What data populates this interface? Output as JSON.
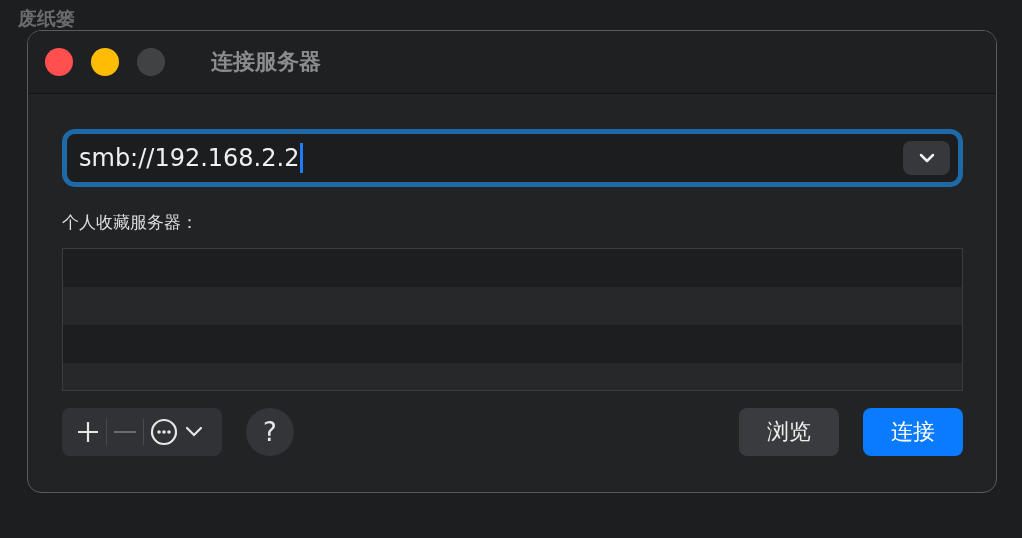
{
  "desktop": {
    "icon_label": "废纸篓"
  },
  "window": {
    "title": "连接服务器",
    "traffic_lights": [
      {
        "color": "#ff4f4f"
      },
      {
        "color": "#febc05"
      },
      {
        "color": "#404244"
      }
    ]
  },
  "address_field": {
    "value": "smb://192.168.2.2",
    "focused": true
  },
  "favorites": {
    "label": "个人收藏服务器："
  },
  "toolbar": {
    "add": {
      "disabled": false
    },
    "remove": {
      "disabled": true
    },
    "help": "?"
  },
  "buttons": [
    {
      "label": "浏览",
      "kind": "normal"
    },
    {
      "label": "连接",
      "kind": "default"
    }
  ]
}
